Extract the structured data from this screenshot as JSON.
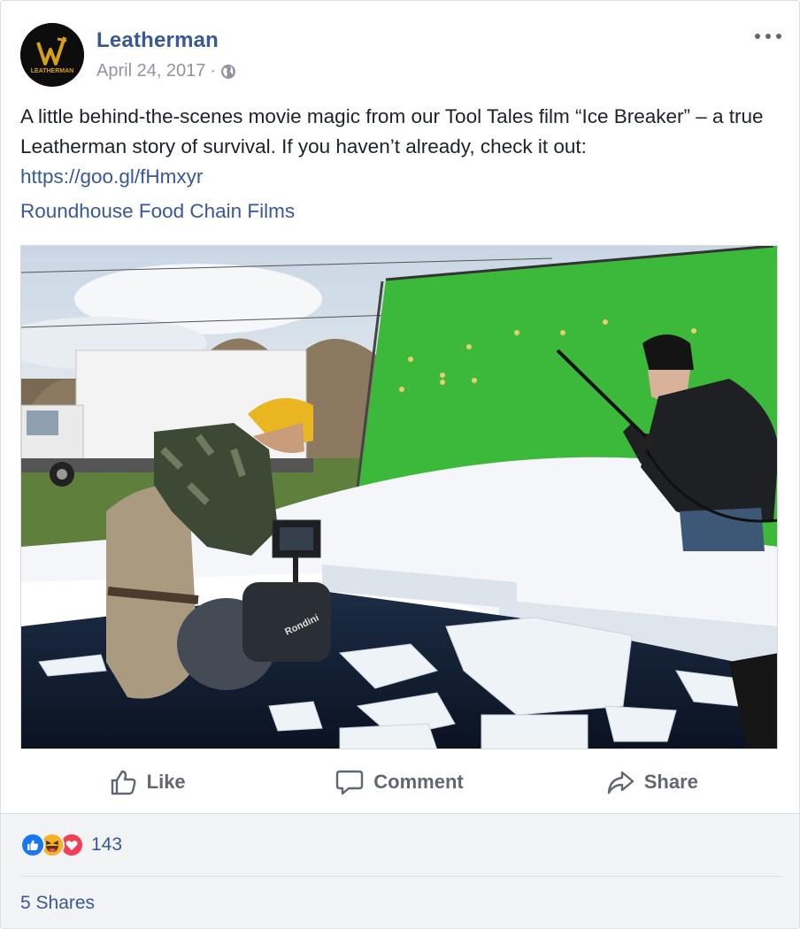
{
  "post": {
    "author": "Leatherman",
    "date": "April 24, 2017",
    "separator": "·",
    "avatar_text": "LEATHERMAN",
    "text_before_link": "A little behind-the-scenes movie magic from our Tool Tales film “Ice Breaker” – a true Leatherman story of survival. If you haven’t already, check it out: ",
    "link": "https://goo.gl/fHmxyr",
    "credit": "Roundhouse Food Chain Films",
    "photo_label": "Behind-the-scenes photo of film crew in icy water in front of a green screen",
    "camera_text": "Rondini"
  },
  "actions": {
    "like": "Like",
    "comment": "Comment",
    "share": "Share"
  },
  "footer": {
    "reaction_count": "143",
    "shares": "5 Shares"
  },
  "icons": {
    "globe": "globe-icon",
    "more": "more-options-icon",
    "like": "thumbs-up-icon",
    "comment": "speech-bubble-icon",
    "share": "share-arrow-icon",
    "reactions": [
      "like-reaction-icon",
      "haha-reaction-icon",
      "love-reaction-icon"
    ]
  },
  "colors": {
    "link": "#385898",
    "muted": "#90949c",
    "action": "#606770",
    "like_blue": "#1877f2",
    "love_red": "#f33e58",
    "haha_yellow": "#f7b125",
    "brand_gold": "#d4a017"
  }
}
